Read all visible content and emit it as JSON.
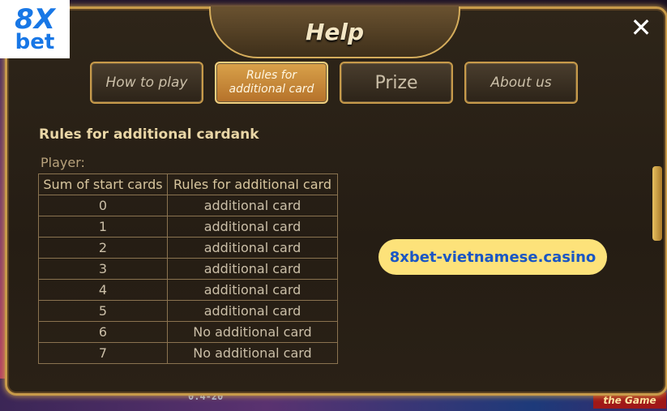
{
  "logo": {
    "line1": "8X",
    "line2": "bet"
  },
  "dialog": {
    "title": "Help",
    "close_glyph": "✕"
  },
  "tabs": [
    {
      "label": "How to play",
      "active": false
    },
    {
      "label_line1": "Rules for",
      "label_line2": "additional card",
      "active": true
    },
    {
      "label": "Prize",
      "active": false
    },
    {
      "label": "About us",
      "active": false
    }
  ],
  "content": {
    "section_title": "Rules for additional cardank",
    "player_label": "Player:",
    "table": {
      "headers": [
        "Sum of start cards",
        "Rules for additional card"
      ],
      "rows": [
        [
          "0",
          "additional card"
        ],
        [
          "1",
          "additional card"
        ],
        [
          "2",
          "additional card"
        ],
        [
          "3",
          "additional card"
        ],
        [
          "4",
          "additional card"
        ],
        [
          "5",
          "additional card"
        ],
        [
          "6",
          "No additional card"
        ],
        [
          "7",
          "No additional card"
        ]
      ]
    }
  },
  "watermark": "8xbet-vietnamese.casino",
  "background": {
    "bottom_number": "0.4-20",
    "bottom_hint": "the Game"
  },
  "colors": {
    "accent_gold": "#c79a4a",
    "active_tab": "#d9a24a",
    "watermark_bg": "#fde27a",
    "watermark_text": "#1a56c4"
  }
}
